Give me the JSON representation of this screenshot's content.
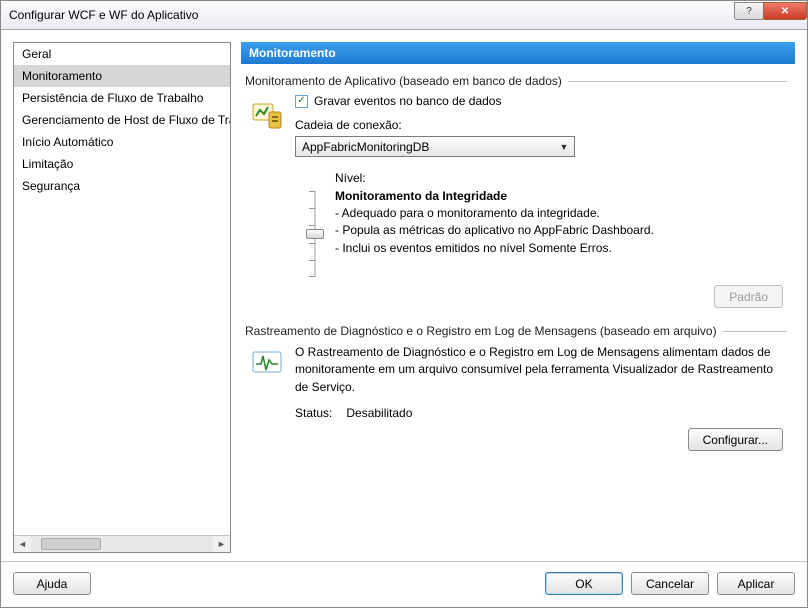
{
  "window": {
    "title": "Configurar WCF e WF do Aplicativo"
  },
  "sidebar": {
    "items": [
      {
        "label": "Geral"
      },
      {
        "label": "Monitoramento"
      },
      {
        "label": "Persistência de Fluxo de Trabalho"
      },
      {
        "label": "Gerenciamento de Host de Fluxo de Trabalho"
      },
      {
        "label": "Início Automático"
      },
      {
        "label": "Limitação"
      },
      {
        "label": "Segurança"
      }
    ],
    "selected_index": 1
  },
  "header": {
    "title": "Monitoramento"
  },
  "group1": {
    "title": "Monitoramento de Aplicativo (baseado em banco de dados)",
    "checkbox_label": "Gravar eventos no banco de dados",
    "conn_label": "Cadeia de conexão:",
    "conn_value": "AppFabricMonitoringDB",
    "level_label": "Nível:",
    "level_title": "Monitoramento da Integridade",
    "bullet1": "- Adequado para o monitoramento da integridade.",
    "bullet2": "- Popula as métricas do aplicativo no AppFabric Dashboard.",
    "bullet3": "- Inclui os eventos emitidos no nível Somente Erros.",
    "default_btn": "Padrão"
  },
  "group2": {
    "title": "Rastreamento de Diagnóstico e o Registro em Log de Mensagens (baseado em arquivo)",
    "desc": "O Rastreamento de Diagnóstico e o Registro em Log de Mensagens alimentam dados de monitoramente em um arquivo consumível pela ferramenta Visualizador de Rastreamento de Serviço.",
    "status_label": "Status:",
    "status_value": "Desabilitado",
    "configure_btn": "Configurar..."
  },
  "footer": {
    "help": "Ajuda",
    "ok": "OK",
    "cancel": "Cancelar",
    "apply": "Aplicar"
  }
}
